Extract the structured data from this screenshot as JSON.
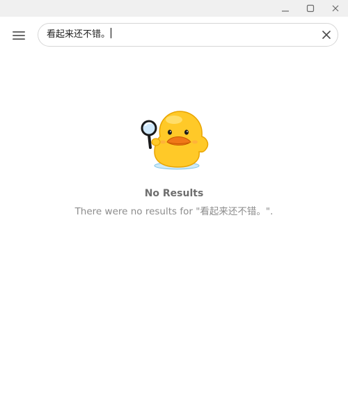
{
  "window": {
    "controls": {
      "minimize_icon": "minimize-icon",
      "maximize_icon": "maximize-icon",
      "close_icon": "close-icon"
    }
  },
  "toolbar": {
    "menu_icon": "hamburger-menu-icon",
    "search": {
      "value": "看起来还不错。",
      "clear_icon": "clear-icon"
    }
  },
  "empty_state": {
    "icon": "duck-magnifier-icon",
    "title": "No Results",
    "description": "There were no results for \"看起来还不错。\"."
  },
  "colors": {
    "titlebar_bg": "#f0f0f0",
    "title_text": "#6e6e6e",
    "desc_text": "#8c8c8c",
    "duck_yellow": "#ffc928",
    "beak_orange": "#f07818"
  }
}
